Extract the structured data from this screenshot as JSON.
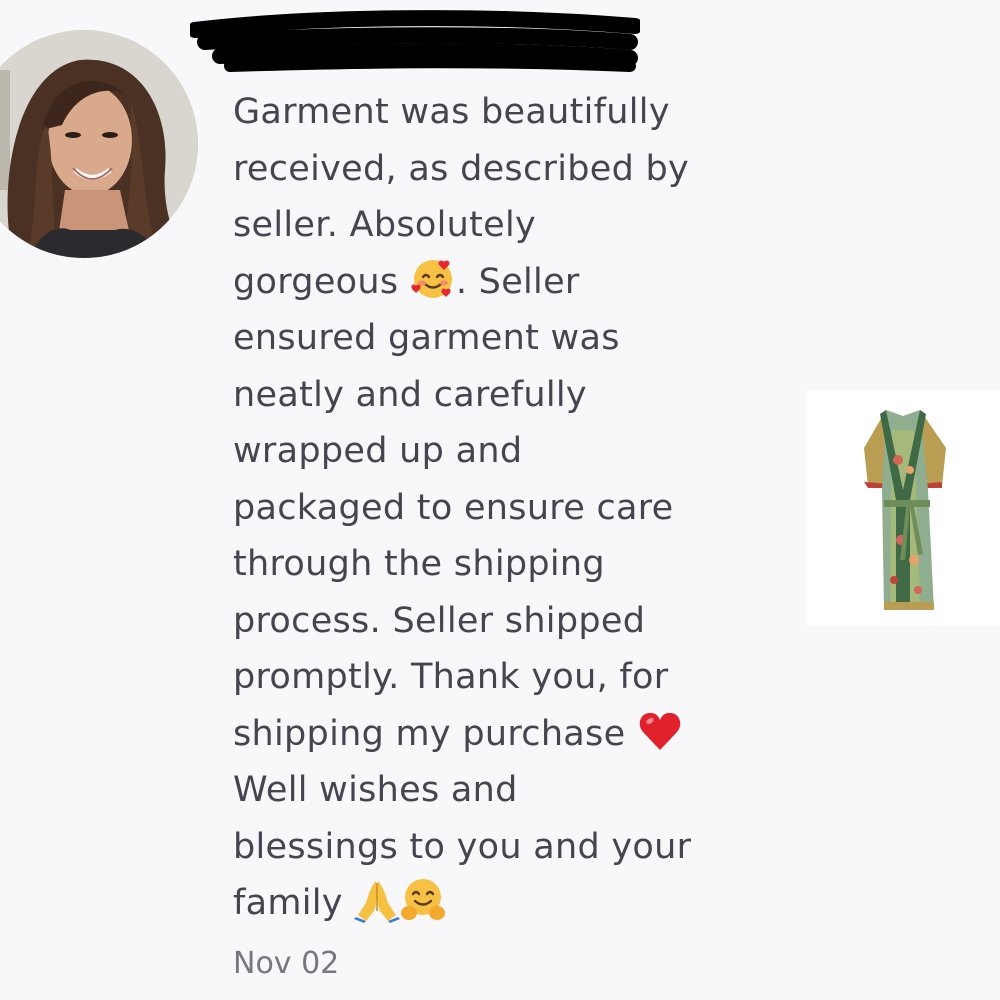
{
  "review": {
    "lines": [
      "Garment was beautifully",
      "received, as described by",
      "seller. Absolutely",
      "gorgeous",
      ". Seller",
      "ensured garment was",
      "neatly and carefully",
      "wrapped up and",
      "packaged to ensure care",
      "through the shipping",
      "process. Seller shipped",
      "promptly. Thank you, for",
      "shipping my purchase",
      "Well wishes and",
      "blessings to you and your",
      "family"
    ],
    "date": "Nov 02"
  },
  "icons": {
    "avatar": "reviewer-avatar",
    "emoji_1": "smiling-face-with-hearts-icon",
    "emoji_2": "red-heart-icon",
    "emoji_3": "folded-hands-icon",
    "emoji_4": "hugging-face-icon",
    "product": "kimono-robe-thumbnail"
  },
  "colors": {
    "background": "#f8f8fa",
    "text": "#454550",
    "date": "#77777f",
    "redaction": "#000000"
  }
}
